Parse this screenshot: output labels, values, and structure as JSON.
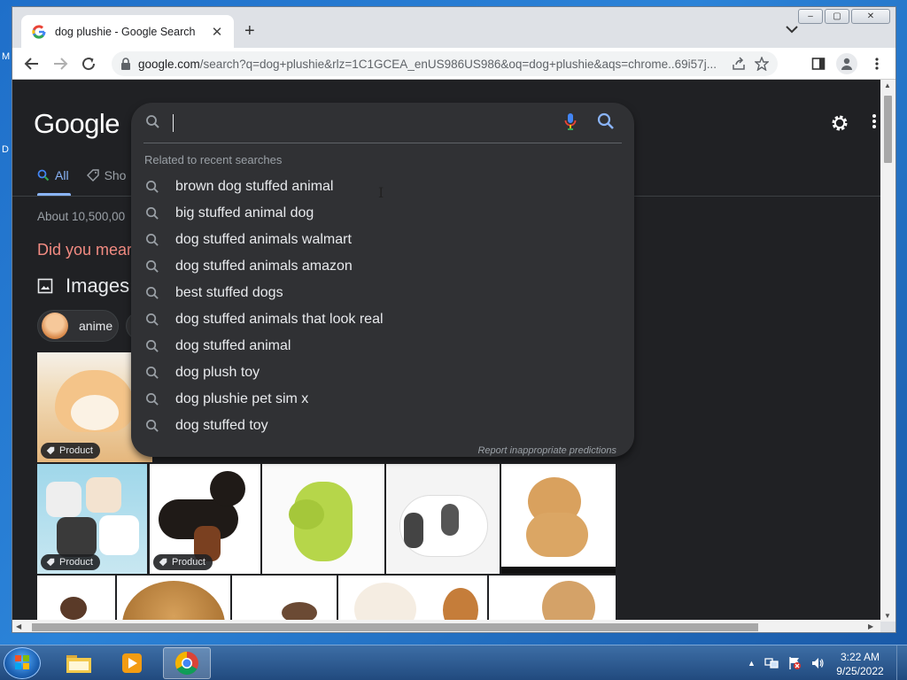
{
  "desktop": {
    "fragment_1": "M",
    "fragment_2": "D"
  },
  "browser": {
    "tab_title": "dog plushie - Google Search",
    "new_tab": "+",
    "tab_close": "✕",
    "url_host": "google.com",
    "url_path": "/search?q=dog+plushie&rlz=1C1GCEA_enUS986US986&oq=dog+plushie&aqs=chrome..69i57j...",
    "window_controls": {
      "minimize": "‒",
      "maximize": "▢",
      "close": "✕"
    }
  },
  "page": {
    "logo": "Google",
    "tabs": [
      {
        "label": "All"
      },
      {
        "label": "Sho"
      }
    ],
    "about": "About 10,500,00",
    "did_you_mean": "Did you mear",
    "images_heading": "Images",
    "chips": [
      {
        "label": "anime"
      }
    ],
    "product_badge": "Product"
  },
  "search": {
    "query": "",
    "related_heading": "Related to recent searches",
    "suggestions": [
      "brown dog stuffed animal",
      "big stuffed animal dog",
      "dog stuffed animals walmart",
      "dog stuffed animals amazon",
      "best stuffed dogs",
      "dog stuffed animals that look real",
      "dog stuffed animal",
      "dog plush toy",
      "dog plushie pet sim x",
      "dog stuffed toy"
    ],
    "report_link": "Report inappropriate predictions"
  },
  "taskbar": {
    "time": "3:22 AM",
    "date": "9/25/2022"
  },
  "colors": {
    "page_bg": "#202124",
    "dropdown_bg": "#303134",
    "accent_blue": "#8ab4f8",
    "did_you_mean_red": "#f28b82"
  }
}
